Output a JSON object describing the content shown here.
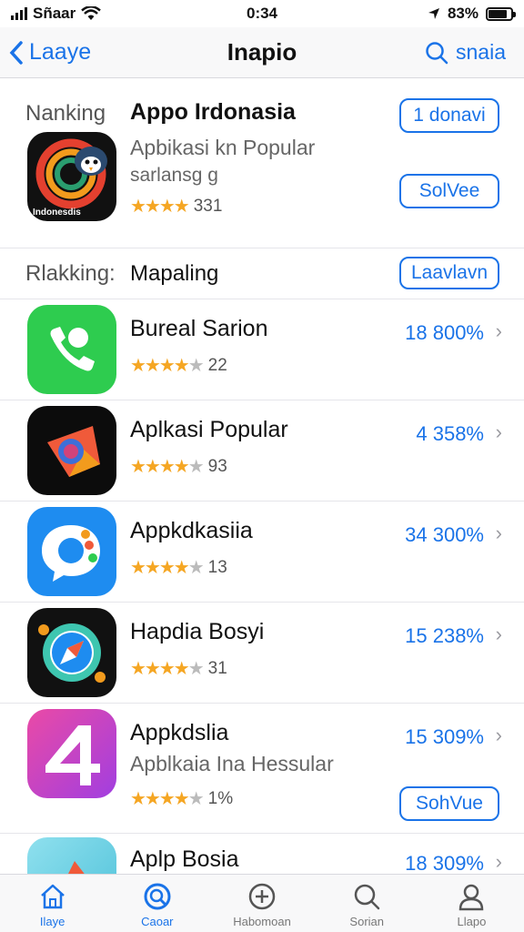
{
  "status": {
    "carrier": "Sñaar",
    "time": "0:34",
    "battery": "83%"
  },
  "nav": {
    "back_label": "Laaye",
    "title": "Inapio",
    "search_label": "snaia"
  },
  "featured": {
    "ranking_label": "Nanking",
    "title": "Appo Irdonasia",
    "subtitle": "Apbikasi kn Popular",
    "subtitle2": "sarlansg g",
    "rating_count": "331",
    "icon_text": "Indonesdis",
    "button_top": "1 donavi",
    "button_bottom": "SolVee"
  },
  "section2": {
    "ranking_label": "Rlakking:",
    "title": "Mapaling",
    "button": "Laavlavn"
  },
  "apps": [
    {
      "title": "Bureal Sarion",
      "stat": "18 800%",
      "rating_count": "22",
      "stars": 4,
      "icon": "phone-icon",
      "color": "#2ecc4f"
    },
    {
      "title": "Aplkasi Popular",
      "stat": "4 358%",
      "rating_count": "93",
      "stars": 4,
      "icon": "kite-icon",
      "color": "#0c0c0c"
    },
    {
      "title": "Appkdkasiia",
      "stat": "34 300%",
      "rating_count": "13",
      "stars": 4,
      "icon": "chat-icon",
      "color": "#1e8cf0"
    },
    {
      "title": "Hapdia Bosyi",
      "stat": "15 238%",
      "rating_count": "31",
      "stars": 4,
      "icon": "compass-icon",
      "color": "#111111"
    },
    {
      "title": "Appkdslia",
      "stat": "15 309%",
      "rating_count": "1%",
      "stars": 4,
      "subtitle": "Apblkaia Ina Hessular",
      "button": "SohVue",
      "icon": "number-four-icon",
      "color": "#c13fd8"
    },
    {
      "title": "Aplp Bosia",
      "stat": "18 309%",
      "icon": "shape-icon",
      "color": "#7fd3e6"
    }
  ],
  "tabs": [
    {
      "label": "Ilaye",
      "icon": "home-icon",
      "active": true
    },
    {
      "label": "Caoar",
      "icon": "discover-icon",
      "active": false
    },
    {
      "label": "Habomoan",
      "icon": "plus-circle-icon",
      "active": false
    },
    {
      "label": "Sorian",
      "icon": "search-icon",
      "active": false
    },
    {
      "label": "Llapo",
      "icon": "profile-icon",
      "active": false
    }
  ]
}
